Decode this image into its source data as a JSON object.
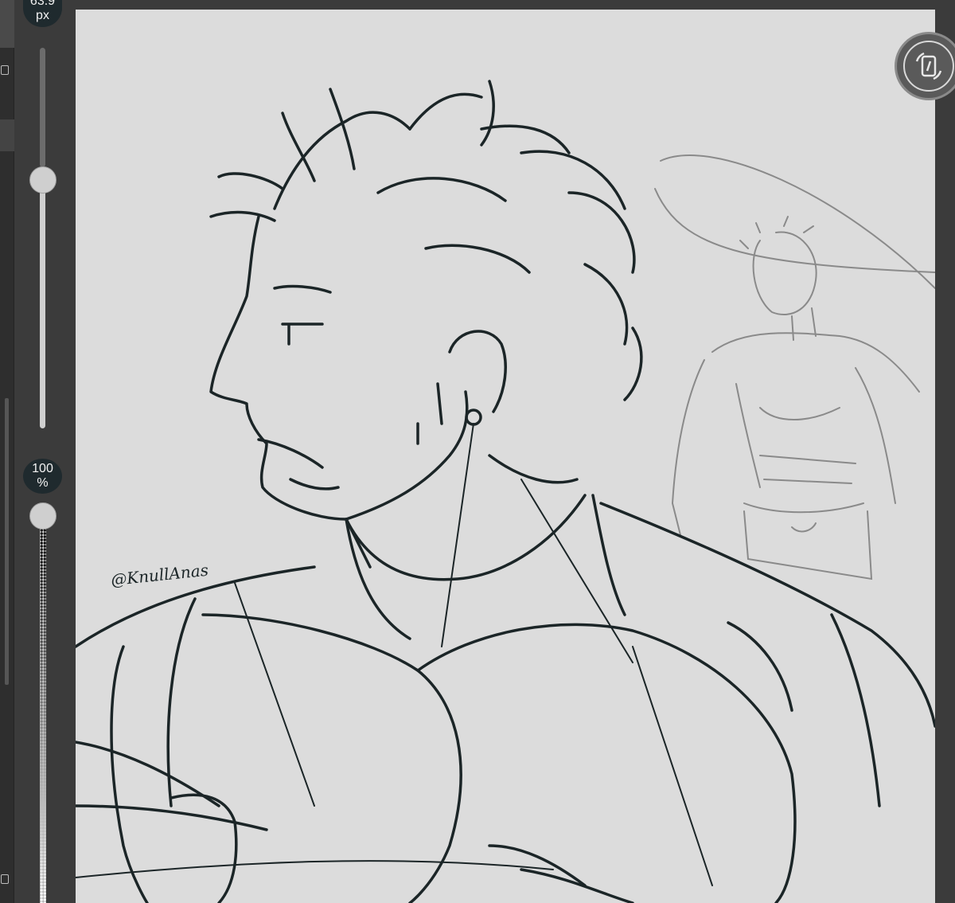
{
  "brush_size": {
    "value": "63.9",
    "unit": "px"
  },
  "opacity": {
    "value": "100",
    "unit": "%"
  },
  "canvas": {
    "signature": "@KnullAnas",
    "line_color": "#1b2527",
    "sketch_color": "#8a8a8a",
    "paper_color": "#dcdcdc"
  },
  "icons": {
    "rotate_canvas": "rotate-canvas-icon"
  }
}
